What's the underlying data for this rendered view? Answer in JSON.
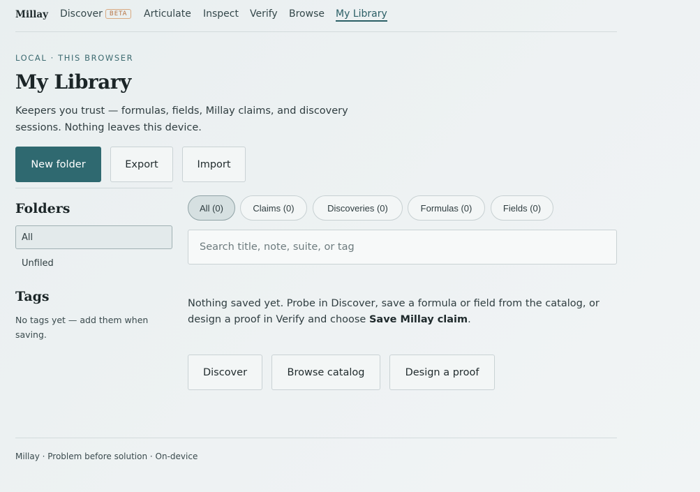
{
  "nav": {
    "brand": "Millay",
    "items": [
      {
        "label": "Discover",
        "badge": "BETA"
      },
      {
        "label": "Articulate"
      },
      {
        "label": "Inspect"
      },
      {
        "label": "Verify"
      },
      {
        "label": "Browse"
      },
      {
        "label": "My Library",
        "active": true
      }
    ]
  },
  "header": {
    "eyebrow": "LOCAL · THIS BROWSER",
    "title": "My Library",
    "lede": "Keepers you trust — formulas, fields, Millay claims, and discovery sessions. Nothing leaves this device."
  },
  "actions": {
    "new_folder": "New folder",
    "export": "Export",
    "import": "Import"
  },
  "sidebar": {
    "folders_heading": "Folders",
    "folders": [
      {
        "label": "All",
        "active": true
      },
      {
        "label": "Unfiled"
      }
    ],
    "tags_heading": "Tags",
    "tags_note": "No tags yet — add them when saving."
  },
  "filters": {
    "chips": [
      {
        "label": "All (0)",
        "active": true
      },
      {
        "label": "Claims (0)"
      },
      {
        "label": "Discoveries (0)"
      },
      {
        "label": "Formulas (0)"
      },
      {
        "label": "Fields (0)"
      }
    ],
    "search_placeholder": "Search title, note, suite, or tag"
  },
  "empty_state": {
    "text_before": "Nothing saved yet. Probe in Discover, save a formula or field from the catalog, or design a proof in Verify and choose ",
    "text_bold": "Save Millay claim",
    "text_after": ".",
    "buttons": {
      "discover": "Discover",
      "browse_catalog": "Browse catalog",
      "design_proof": "Design a proof"
    }
  },
  "footer": {
    "text": "Millay · Problem before solution · On-device"
  },
  "colors": {
    "accent": "#2f6970",
    "beta_badge": "#b5703e"
  }
}
